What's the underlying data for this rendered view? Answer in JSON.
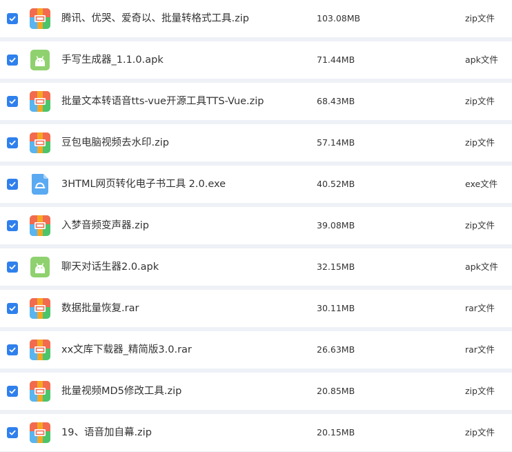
{
  "files": [
    {
      "name": "腾讯、优哭、爱奇以、批量转格式工具.zip",
      "size": "103.08MB",
      "type": "zip文件",
      "icon": "archive-icon",
      "checked": true
    },
    {
      "name": "手写生成器_1.1.0.apk",
      "size": "71.44MB",
      "type": "apk文件",
      "icon": "android-icon",
      "checked": true
    },
    {
      "name": "批量文本转语音tts-vue开源工具TTS-Vue.zip",
      "size": "68.43MB",
      "type": "zip文件",
      "icon": "archive-icon",
      "checked": true
    },
    {
      "name": "豆包电脑视频去水印.zip",
      "size": "57.14MB",
      "type": "zip文件",
      "icon": "archive-icon",
      "checked": true
    },
    {
      "name": "3HTML网页转化电子书工具 2.0.exe",
      "size": "40.52MB",
      "type": "exe文件",
      "icon": "exe-icon",
      "checked": true
    },
    {
      "name": "入梦音频变声器.zip",
      "size": "39.08MB",
      "type": "zip文件",
      "icon": "archive-icon",
      "checked": true
    },
    {
      "name": "聊天对话生器2.0.apk",
      "size": "32.15MB",
      "type": "apk文件",
      "icon": "android-icon",
      "checked": true
    },
    {
      "name": "数据批量恢复.rar",
      "size": "30.11MB",
      "type": "rar文件",
      "icon": "archive-icon",
      "checked": true
    },
    {
      "name": "xx文库下载器_精简版3.0.rar",
      "size": "26.63MB",
      "type": "rar文件",
      "icon": "archive-icon",
      "checked": true
    },
    {
      "name": "批量视频MD5修改工具.zip",
      "size": "20.85MB",
      "type": "zip文件",
      "icon": "archive-icon",
      "checked": true
    },
    {
      "name": "19、语音加自幕.zip",
      "size": "20.15MB",
      "type": "zip文件",
      "icon": "archive-icon",
      "checked": true
    }
  ],
  "colors": {
    "checkbox": "#2f80ed",
    "archive_top": "#f36b4f",
    "archive_left": "#5ab4f0",
    "archive_right": "#4cc46c",
    "archive_band": "#f5a623",
    "android": "#8fd16f",
    "exe": "#5aaaf2"
  }
}
